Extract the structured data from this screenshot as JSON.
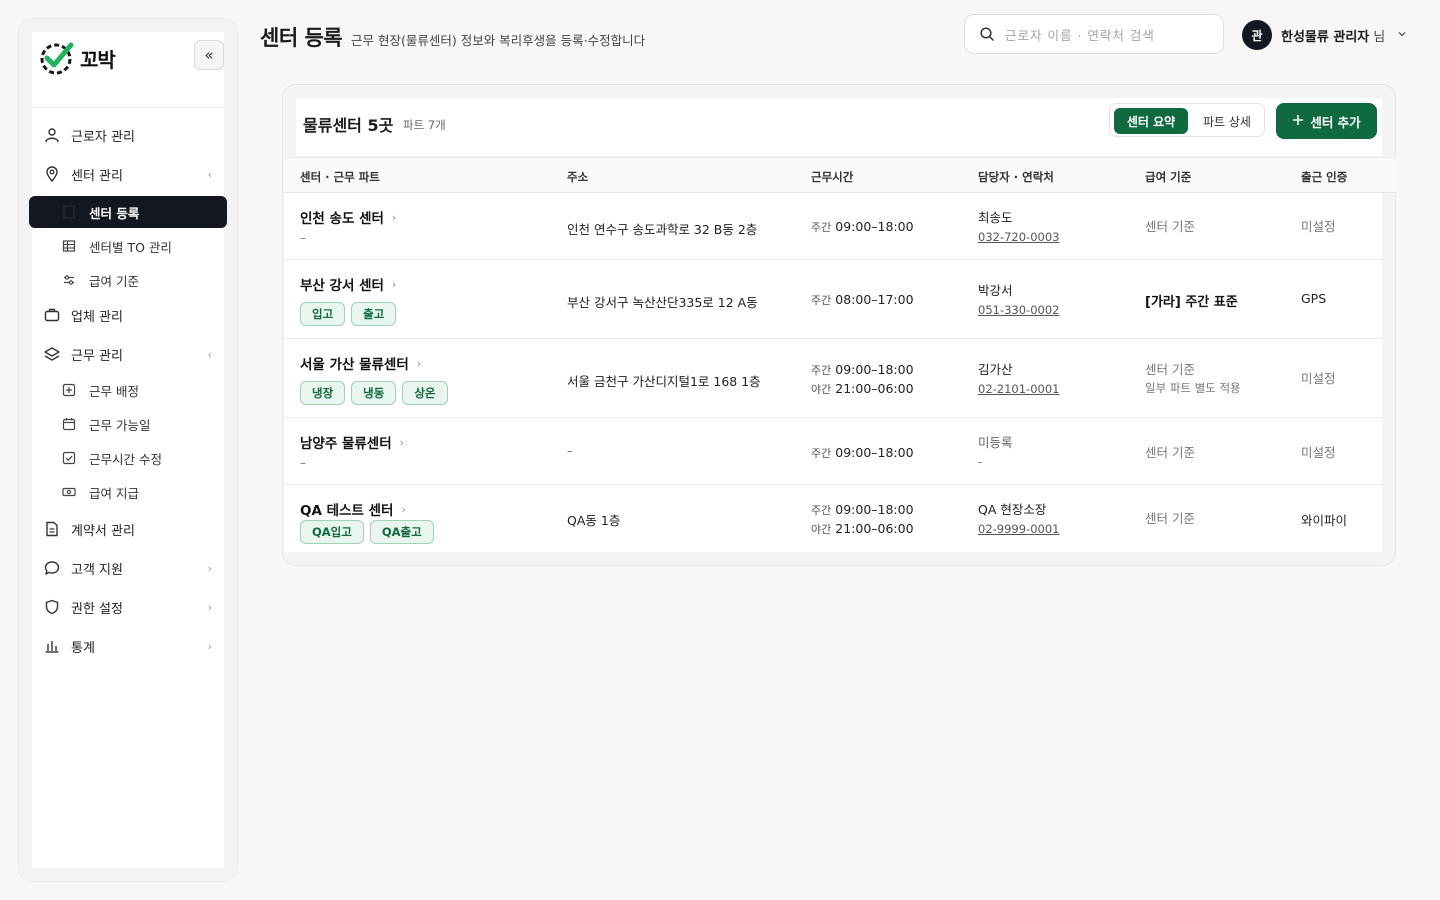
{
  "sidebar": {
    "brand": "꼬박",
    "collapse_icon": "«",
    "items": [
      {
        "label": "근로자 관리",
        "icon": "user-icon"
      },
      {
        "label": "센터 관리",
        "icon": "map-pin-icon",
        "chevron": "‹"
      },
      {
        "label": "업체 관리",
        "icon": "briefcase-icon"
      },
      {
        "label": "근무 관리",
        "icon": "layers-icon",
        "chevron": "‹"
      },
      {
        "label": "계약서 관리",
        "icon": "document-icon"
      },
      {
        "label": "고객 지원",
        "icon": "chat-icon",
        "chevron": "›"
      },
      {
        "label": "권한 설정",
        "icon": "shield-icon",
        "chevron": "›"
      },
      {
        "label": "통계",
        "icon": "bar-chart-icon",
        "chevron": "›"
      }
    ],
    "center_sub": [
      {
        "label": "센터 등록",
        "icon": "building-icon"
      },
      {
        "label": "센터별 TO 관리",
        "icon": "table-icon"
      },
      {
        "label": "급여 기준",
        "icon": "sliders-icon"
      }
    ],
    "work_sub": [
      {
        "label": "근무 배정",
        "icon": "plus-square-icon"
      },
      {
        "label": "근무 가능일",
        "icon": "calendar-icon"
      },
      {
        "label": "근무시간 수정",
        "icon": "check-square-icon"
      },
      {
        "label": "급여 지급",
        "icon": "cash-icon"
      }
    ]
  },
  "header": {
    "title": "센터 등록",
    "subtitle": "근무 현장(물류센터) 정보와 복리후생을 등록·수정합니다",
    "search_placeholder": "근로자 이름 · 연락처 검색",
    "avatar": "관",
    "user_name": "한성물류 관리자",
    "user_suffix": "님"
  },
  "card": {
    "title": "물류센터 5곳",
    "subtitle": "파트 7개",
    "seg_on": "센터 요약",
    "seg_off": "파트 상세",
    "add_label": "센터 추가",
    "columns": [
      "센터 · 근무 파트",
      "주소",
      "근무시간",
      "담당자 · 연락처",
      "급여 기준",
      "출근 인증"
    ],
    "rows": [
      {
        "name": "인천 송도 센터",
        "parts": [],
        "parts_empty": "–",
        "address": "인천 연수구 송도과학로 32 B동 2층",
        "hours": [
          {
            "pre": "주간",
            "time": "09:00–18:00"
          }
        ],
        "manager": "최송도",
        "phone": "032-720-0003",
        "pay": [
          "센터 기준"
        ],
        "pay_bold": false,
        "auth": "미설정",
        "auth_muted": true
      },
      {
        "name": "부산 강서 센터",
        "parts": [
          "입고",
          "출고"
        ],
        "parts_empty": "",
        "address": "부산 강서구 녹산산단335로 12 A동",
        "hours": [
          {
            "pre": "주간",
            "time": "08:00–17:00"
          }
        ],
        "manager": "박강서",
        "phone": "051-330-0002",
        "pay": [
          "[가라] 주간 표준"
        ],
        "pay_bold": true,
        "auth": "GPS",
        "auth_muted": false
      },
      {
        "name": "서울 가산 물류센터",
        "parts": [
          "냉장",
          "냉동",
          "상온"
        ],
        "parts_empty": "",
        "address": "서울 금천구 가산디지털1로 168 1층",
        "hours": [
          {
            "pre": "주간",
            "time": "09:00–18:00"
          },
          {
            "pre": "야간",
            "time": "21:00–06:00"
          }
        ],
        "manager": "김가산",
        "phone": "02-2101-0001",
        "pay": [
          "센터 기준",
          "일부 파트 별도 적용"
        ],
        "pay_bold": false,
        "auth": "미설정",
        "auth_muted": true
      },
      {
        "name": "남양주 물류센터",
        "parts": [],
        "parts_empty": "–",
        "address": "–",
        "hours": [
          {
            "pre": "주간",
            "time": "09:00–18:00"
          }
        ],
        "manager": "미등록",
        "phone": "-",
        "pay": [
          "센터 기준"
        ],
        "pay_bold": false,
        "auth": "미설정",
        "auth_muted": true
      },
      {
        "name": "QA 테스트 센터",
        "parts": [
          "QA입고",
          "QA출고"
        ],
        "parts_empty": "",
        "address": "QA동 1층",
        "hours": [
          {
            "pre": "주간",
            "time": "09:00–18:00"
          },
          {
            "pre": "야간",
            "time": "21:00–06:00"
          }
        ],
        "manager": "QA 현장소장",
        "phone": "02-9999-0001",
        "pay": [
          "센터 기준"
        ],
        "pay_bold": false,
        "auth": "와이파이",
        "auth_muted": false
      }
    ]
  },
  "colors": {
    "brand_green": "#0f6b3f",
    "dark": "#131722",
    "tag_bg": "#e9f6ef"
  }
}
